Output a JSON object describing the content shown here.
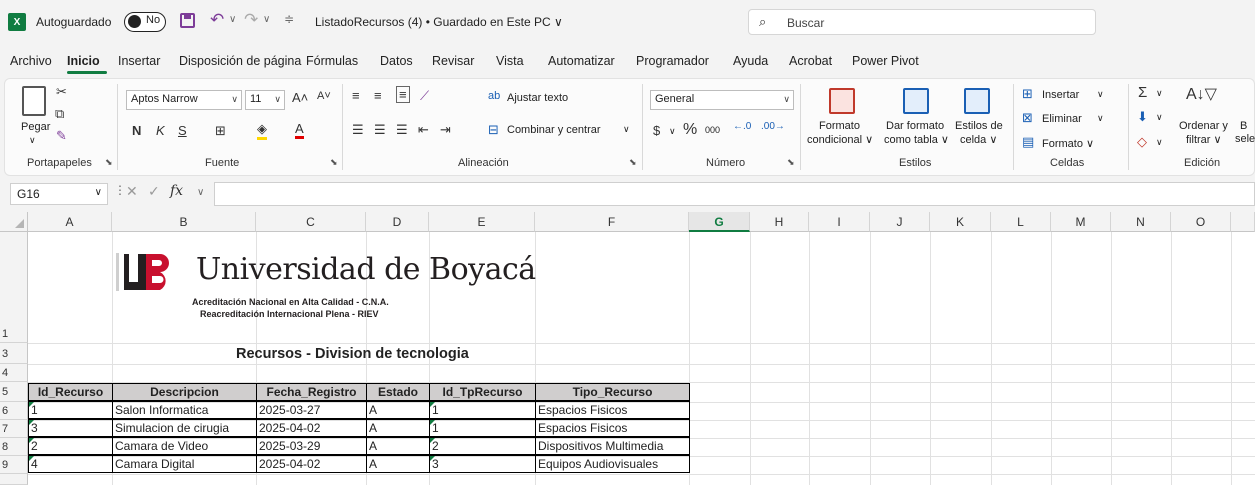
{
  "titlebar": {
    "autosave_label": "Autoguardado",
    "autosave_state": "No",
    "doc_title": "ListadoRecursos (4) • Guardado en Este PC ∨",
    "search_placeholder": "Buscar"
  },
  "menu": {
    "tabs": [
      "Archivo",
      "Inicio",
      "Insertar",
      "Disposición de página",
      "Fórmulas",
      "Datos",
      "Revisar",
      "Vista",
      "Automatizar",
      "Programador",
      "Ayuda",
      "Acrobat",
      "Power Pivot"
    ],
    "active": "Inicio"
  },
  "ribbon": {
    "clipboard": {
      "paste": "Pegar",
      "group": "Portapapeles"
    },
    "font": {
      "name": "Aptos Narrow",
      "size": "11",
      "bold": "N",
      "italic": "K",
      "underline": "S",
      "group": "Fuente"
    },
    "alignment": {
      "wrap": "Ajustar texto",
      "merge": "Combinar y centrar",
      "group": "Alineación"
    },
    "number": {
      "format": "General",
      "currency": "$",
      "percent": "%",
      "thousands": "000",
      "group": "Número"
    },
    "styles": {
      "conditional_1": "Formato",
      "conditional_2": "condicional ∨",
      "table_1": "Dar formato",
      "table_2": "como tabla ∨",
      "cell_1": "Estilos de",
      "cell_2": "celda ∨",
      "group": "Estilos"
    },
    "cells": {
      "insert": "Insertar",
      "delete": "Eliminar",
      "format": "Formato ∨",
      "group": "Celdas"
    },
    "editing": {
      "sort_1": "Ordenar y",
      "sort_2": "filtrar ∨",
      "find_1": "B",
      "find_2": "sele",
      "group": "Edición"
    }
  },
  "formula_bar": {
    "name_box": "G16",
    "fx": "fx",
    "content": ""
  },
  "grid": {
    "columns": [
      "A",
      "B",
      "C",
      "D",
      "E",
      "F",
      "G",
      "H",
      "I",
      "J",
      "K",
      "L",
      "M",
      "N",
      "O"
    ],
    "selected_column": "G",
    "rows": [
      "1",
      "3",
      "4",
      "5",
      "6",
      "7",
      "8",
      "9"
    ]
  },
  "logo": {
    "name": "Universidad de Boyacá",
    "line1": "Acreditación Nacional en Alta Calidad - C.N.A.",
    "line2": "Reacreditación Internacional Plena - RIEV"
  },
  "sheet": {
    "title": "Recursos - Division de tecnologia",
    "headers": [
      "Id_Recurso",
      "Descripcion",
      "Fecha_Registro",
      "Estado",
      "Id_TpRecurso",
      "Tipo_Recurso"
    ],
    "rows": [
      [
        "1",
        "Salon Informatica",
        "2025-03-27",
        "A",
        "1",
        "Espacios Fisicos"
      ],
      [
        "3",
        "Simulacion de cirugia",
        "2025-04-02",
        "A",
        "1",
        "Espacios Fisicos"
      ],
      [
        "2",
        "Camara de Video",
        "2025-03-29",
        "A",
        "2",
        "Dispositivos Multimedia"
      ],
      [
        "4",
        "Camara Digital",
        "2025-04-02",
        "A",
        "3",
        "Equipos Audiovisuales"
      ]
    ]
  },
  "colors": {
    "excel_green": "#107c41",
    "header_fill": "#d0cece",
    "brand_red": "#c8102e"
  }
}
